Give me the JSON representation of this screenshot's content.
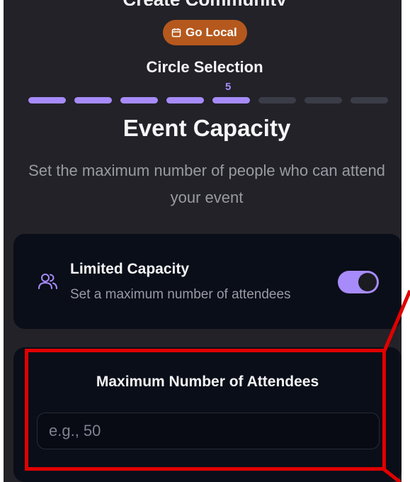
{
  "header": {
    "partial_title": "Create Community",
    "badge_label": "Go Local",
    "badge_icon": "calendar-icon",
    "step_title": "Circle Selection",
    "step_number": "5",
    "progress": {
      "current": 5,
      "total": 8
    }
  },
  "main": {
    "heading": "Event Capacity",
    "subtitle": "Set the maximum number of people who can attend your event"
  },
  "capacity_card": {
    "icon": "users-icon",
    "title": "Limited Capacity",
    "description": "Set a maximum number of attendees",
    "toggle_on": true
  },
  "max_card": {
    "label": "Maximum Number of Attendees",
    "input_value": "",
    "input_placeholder": "e.g., 50"
  },
  "colors": {
    "background": "#222228",
    "card": "#0a0e18",
    "accent": "#a78bfa",
    "badge": "#b5581d",
    "highlight": "#e00000"
  }
}
